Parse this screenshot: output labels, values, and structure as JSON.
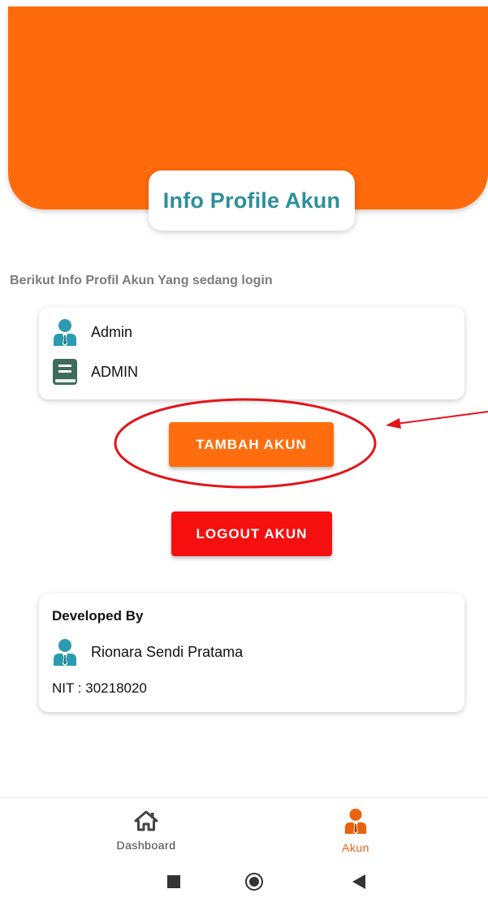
{
  "header": {
    "title": "Info Profile Akun"
  },
  "subtitle": "Berikut Info Profil Akun Yang sedang login",
  "profile": {
    "name": "Admin",
    "role": "ADMIN"
  },
  "buttons": {
    "add_account": "TAMBAH AKUN",
    "logout": "LOGOUT AKUN"
  },
  "developer": {
    "title": "Developed By",
    "name": "Rionara Sendi Pratama",
    "nit": "NIT : 30218020"
  },
  "bottom_nav": {
    "items": [
      {
        "label": "Dashboard",
        "icon": "home-icon",
        "active": false
      },
      {
        "label": "Akun",
        "icon": "user-icon",
        "active": true
      }
    ]
  },
  "system_nav": {
    "icons": [
      "recent-apps-icon",
      "home-circle-icon",
      "back-icon"
    ]
  },
  "colors": {
    "header": "#ff6a0c",
    "title": "#2d8f9a",
    "add_button": "#ff6d0e",
    "logout_button": "#f50f0f",
    "active_nav": "#e8640e",
    "annotation": "#e4141a"
  }
}
